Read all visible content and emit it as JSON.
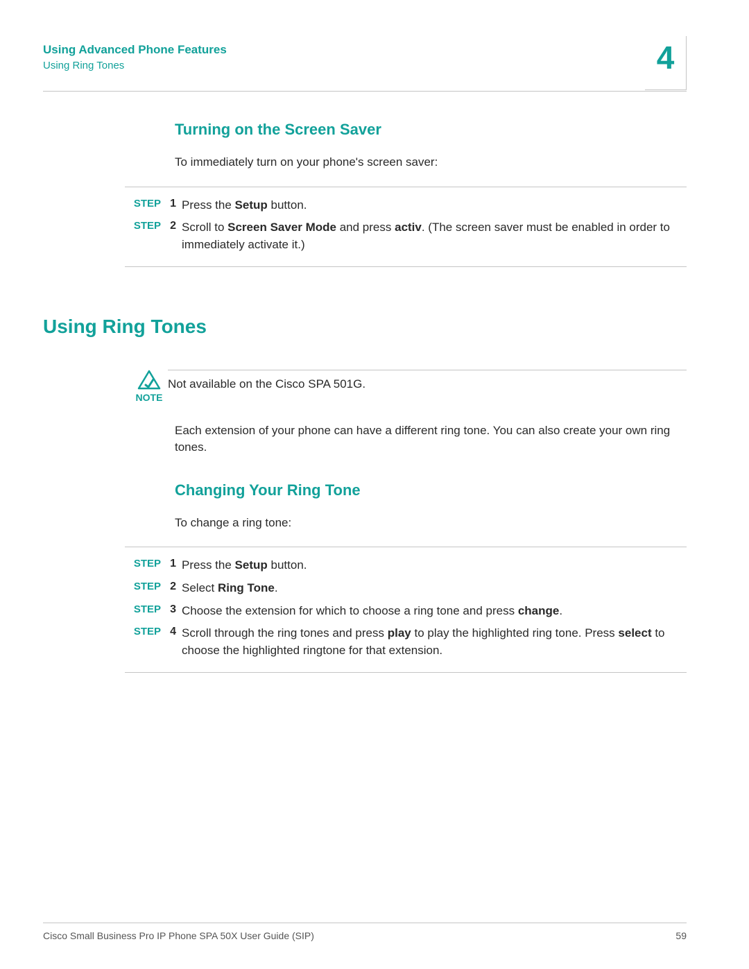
{
  "header": {
    "title": "Using Advanced Phone Features",
    "subtitle": "Using Ring Tones",
    "chapter": "4"
  },
  "section1": {
    "heading": "Turning on the Screen Saver",
    "intro": "To immediately turn on your phone's screen saver:",
    "steps": [
      {
        "label": "STEP",
        "num": "1",
        "pre1": "Press the ",
        "b1": "Setup",
        "post1": " button."
      },
      {
        "label": "STEP",
        "num": "2",
        "pre1": "Scroll to ",
        "b1": "Screen Saver Mode",
        "mid1": " and press ",
        "b2": "activ",
        "post1": ". (The screen saver must be enabled in order to immediately activate it.)"
      }
    ]
  },
  "section2": {
    "heading": "Using Ring Tones",
    "note": {
      "label": "NOTE",
      "text": "Not available on the Cisco SPA 501G."
    },
    "body": "Each extension of your phone can have a different ring tone. You can also create your own ring tones."
  },
  "section3": {
    "heading": "Changing Your Ring Tone",
    "intro": "To change a ring tone:",
    "steps": [
      {
        "label": "STEP",
        "num": "1",
        "pre1": "Press the ",
        "b1": "Setup",
        "post1": " button."
      },
      {
        "label": "STEP",
        "num": "2",
        "pre1": "Select ",
        "b1": "Ring Tone",
        "post1": "."
      },
      {
        "label": "STEP",
        "num": "3",
        "pre1": "Choose the extension for which to choose a ring tone and press ",
        "b1": "change",
        "post1": "."
      },
      {
        "label": "STEP",
        "num": "4",
        "pre1": "Scroll through the ring tones and press ",
        "b1": "play",
        "mid1": " to play the highlighted ring tone. Press ",
        "b2": "select",
        "post1": " to choose the highlighted ringtone for that extension."
      }
    ]
  },
  "footer": {
    "left": "Cisco Small Business Pro IP Phone SPA 50X User Guide (SIP)",
    "right": "59"
  },
  "colors": {
    "teal": "#12a19a"
  }
}
